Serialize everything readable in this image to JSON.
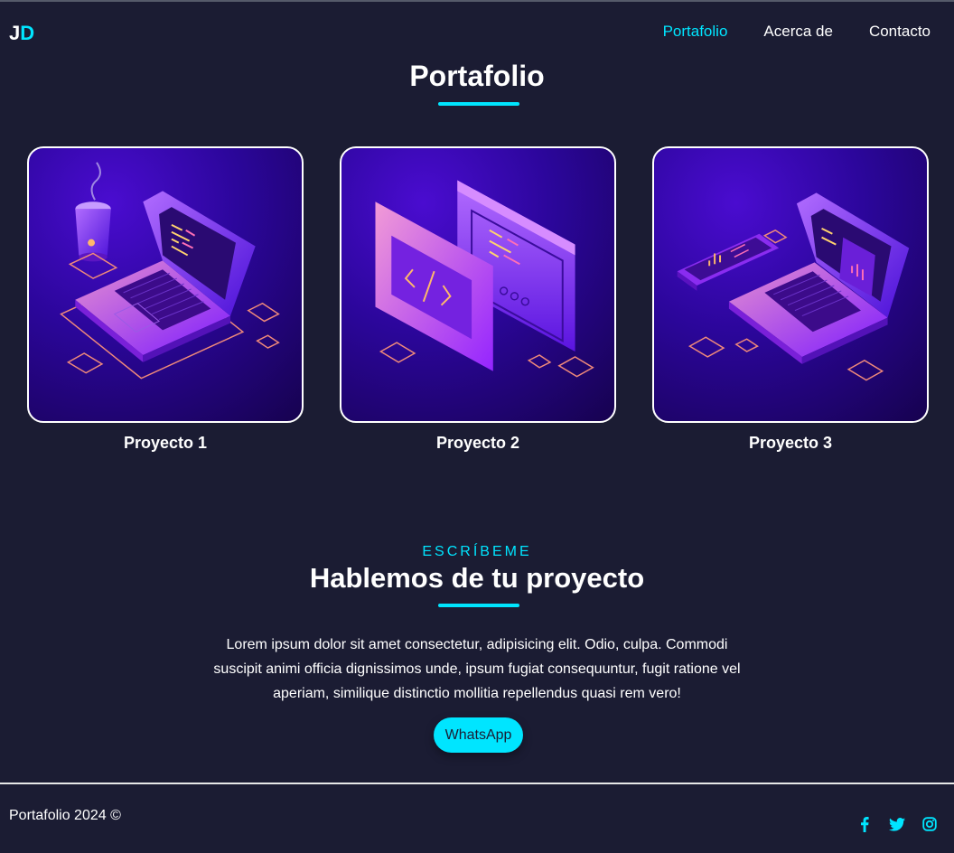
{
  "nav": {
    "logo_part1": "J",
    "logo_part2": "D",
    "links": [
      "Portafolio",
      "Acerca de",
      "Contacto"
    ],
    "active_index": 0
  },
  "portfolio": {
    "title": "Portafolio",
    "projects": [
      {
        "title": "Proyecto 1",
        "image": "laptop-coffee-illustration"
      },
      {
        "title": "Proyecto 2",
        "image": "code-windows-illustration"
      },
      {
        "title": "Proyecto 3",
        "image": "laptop-tablet-illustration"
      }
    ]
  },
  "contact": {
    "kicker": "ESCRÍBEME",
    "title": "Hablemos de tu proyecto",
    "paragraph": "Lorem ipsum dolor sit amet consectetur, adipisicing elit. Odio, culpa. Commodi suscipit animi officia dignissimos unde, ipsum fugiat consequuntur, fugit ratione vel aperiam, similique distinctio mollitia repellendus quasi rem vero!",
    "button_label": "WhatsApp"
  },
  "footer": {
    "copyright": "Portafolio 2024 ©",
    "social_icons": [
      "facebook-icon",
      "twitter-icon",
      "instagram-icon"
    ]
  },
  "colors": {
    "background": "#1b1c33",
    "accent": "#00e5ff",
    "text": "#ffffff"
  }
}
